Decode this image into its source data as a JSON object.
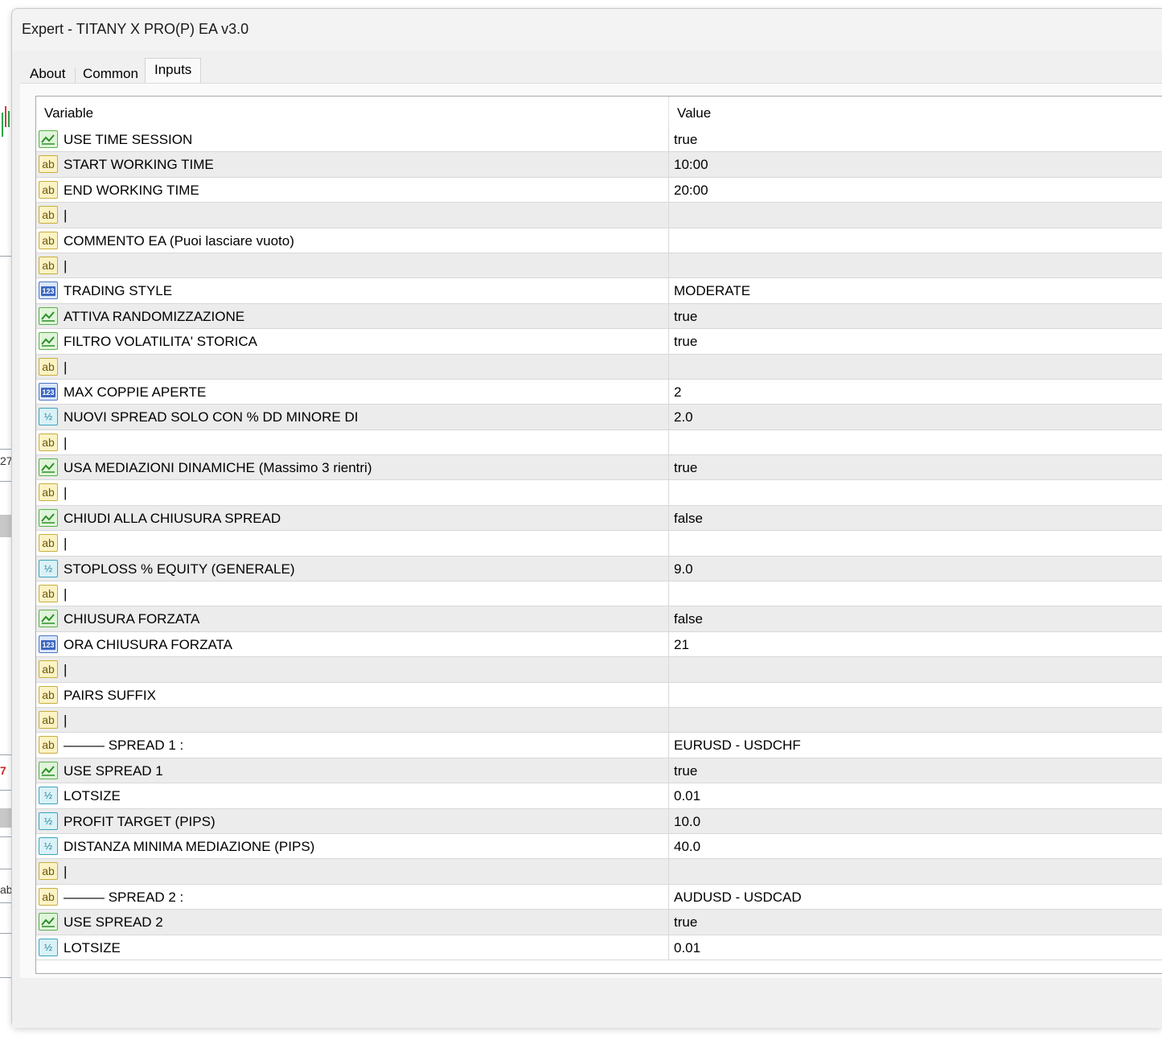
{
  "window": {
    "title": "Expert - TITANY X PRO(P) EA v3.0"
  },
  "tabs": [
    {
      "label": "About"
    },
    {
      "label": "Common"
    },
    {
      "label": "Inputs"
    }
  ],
  "background": {
    "labels": [
      "27",
      "7",
      "ab"
    ]
  },
  "table": {
    "columns": {
      "variable": "Variable",
      "value": "Value"
    },
    "rows": [
      {
        "type": "bool",
        "name": "USE TIME SESSION",
        "value": "true"
      },
      {
        "type": "str",
        "name": "START WORKING TIME",
        "value": "10:00"
      },
      {
        "type": "str",
        "name": "END WORKING TIME",
        "value": "20:00"
      },
      {
        "type": "str",
        "name": "|",
        "value": ""
      },
      {
        "type": "str",
        "name": "COMMENTO EA (Puoi lasciare vuoto)",
        "value": ""
      },
      {
        "type": "str",
        "name": "|",
        "value": ""
      },
      {
        "type": "int",
        "name": "TRADING STYLE",
        "value": "MODERATE"
      },
      {
        "type": "bool",
        "name": "ATTIVA RANDOMIZZAZIONE",
        "value": "true"
      },
      {
        "type": "bool",
        "name": "FILTRO VOLATILITA' STORICA",
        "value": "true"
      },
      {
        "type": "str",
        "name": "|",
        "value": ""
      },
      {
        "type": "int",
        "name": "MAX COPPIE APERTE",
        "value": "2"
      },
      {
        "type": "dbl",
        "name": "NUOVI SPREAD SOLO CON % DD MINORE DI",
        "value": "2.0"
      },
      {
        "type": "str",
        "name": "|",
        "value": ""
      },
      {
        "type": "bool",
        "name": "USA MEDIAZIONI DINAMICHE (Massimo 3 rientri)",
        "value": "true"
      },
      {
        "type": "str",
        "name": "|",
        "value": ""
      },
      {
        "type": "bool",
        "name": "CHIUDI ALLA CHIUSURA SPREAD",
        "value": "false"
      },
      {
        "type": "str",
        "name": "|",
        "value": ""
      },
      {
        "type": "dbl",
        "name": "STOPLOSS % EQUITY (GENERALE)",
        "value": "9.0"
      },
      {
        "type": "str",
        "name": "|",
        "value": ""
      },
      {
        "type": "bool",
        "name": "CHIUSURA FORZATA",
        "value": "false"
      },
      {
        "type": "int",
        "name": "ORA CHIUSURA FORZATA",
        "value": "21"
      },
      {
        "type": "str",
        "name": "|",
        "value": ""
      },
      {
        "type": "str",
        "name": "PAIRS SUFFIX",
        "value": ""
      },
      {
        "type": "str",
        "name": "|",
        "value": ""
      },
      {
        "type": "str",
        "name": "——— SPREAD 1 :",
        "value": "EURUSD - USDCHF"
      },
      {
        "type": "bool",
        "name": "USE SPREAD 1",
        "value": "true"
      },
      {
        "type": "dbl",
        "name": "LOTSIZE",
        "value": "0.01"
      },
      {
        "type": "dbl",
        "name": "PROFIT TARGET (PIPS)",
        "value": "10.0"
      },
      {
        "type": "dbl",
        "name": "DISTANZA MINIMA MEDIAZIONE (PIPS)",
        "value": "40.0"
      },
      {
        "type": "str",
        "name": "|",
        "value": ""
      },
      {
        "type": "str",
        "name": "——— SPREAD 2 :",
        "value": "AUDUSD - USDCAD"
      },
      {
        "type": "bool",
        "name": "USE SPREAD 2",
        "value": "true"
      },
      {
        "type": "dbl",
        "name": "LOTSIZE",
        "value": "0.01"
      }
    ]
  },
  "icons": {
    "bool": "boolean-icon",
    "str": "string-icon",
    "int": "integer-icon",
    "dbl": "double-icon"
  },
  "colors": {
    "bool_border": "#58b04a",
    "str_border": "#c9ad3c",
    "int_border": "#4a74c6",
    "dbl_border": "#3aa3c1"
  }
}
